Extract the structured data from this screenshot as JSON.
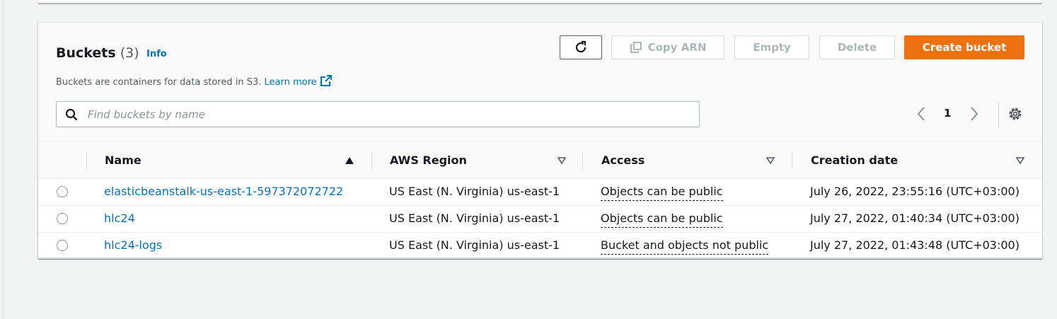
{
  "buckets_panel": {
    "title": "Buckets",
    "count": "(3)",
    "info_label": "Info",
    "description": "Buckets are containers for data stored in S3.",
    "learn_more_label": "Learn more",
    "buttons": {
      "copy_arn": "Copy ARN",
      "empty": "Empty",
      "delete": "Delete",
      "create": "Create bucket"
    },
    "search": {
      "placeholder": "Find buckets by name",
      "value": ""
    },
    "pagination": {
      "current_page": "1"
    },
    "columns": [
      "Name",
      "AWS Region",
      "Access",
      "Creation date"
    ],
    "sort": {
      "column": "Name",
      "direction": "ascending"
    },
    "rows": [
      {
        "name": "elasticbeanstalk-us-east-1-597372072722",
        "region": "US East (N. Virginia) us-east-1",
        "access": "Objects can be public",
        "created": "July 26, 2022, 23:55:16 (UTC+03:00)"
      },
      {
        "name": "hlc24",
        "region": "US East (N. Virginia) us-east-1",
        "access": "Objects can be public",
        "created": "July 27, 2022, 01:40:34 (UTC+03:00)"
      },
      {
        "name": "hlc24-logs",
        "region": "US East (N. Virginia) us-east-1",
        "access": "Bucket and objects not public",
        "created": "July 27, 2022, 01:43:48 (UTC+03:00)"
      }
    ]
  },
  "icons": [
    "refresh-icon",
    "copy-icon",
    "external-link-icon",
    "search-icon",
    "chevron-left-icon",
    "chevron-right-icon",
    "settings-gear-icon",
    "sort-ascending-icon",
    "sort-descending-icon"
  ],
  "colors": {
    "primary": "#ec7211",
    "link": "#0073bb",
    "text": "#16191f",
    "muted": "#545b64",
    "disabled": "#aab7b8"
  }
}
